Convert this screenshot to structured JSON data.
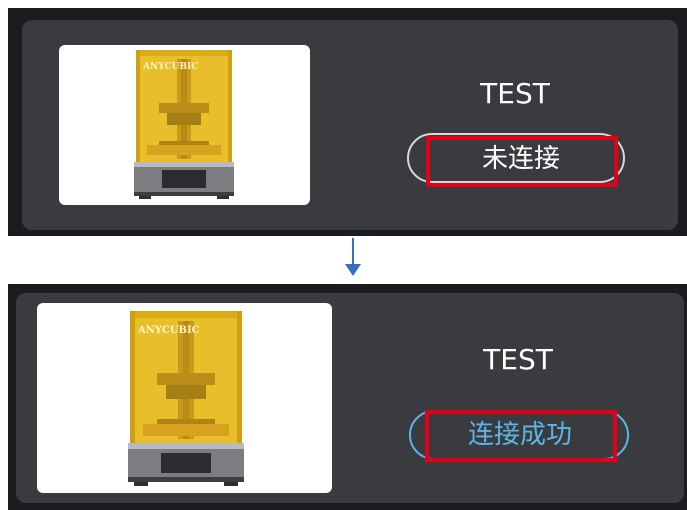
{
  "before": {
    "printer": {
      "name": "TEST",
      "brand_logo": "ANYCUBIC",
      "image_icon": "resin-3d-printer-image"
    },
    "status": {
      "label": "未连接",
      "color": "#ffffff",
      "pill_border": "#d8d8d8"
    }
  },
  "transition": {
    "icon": "arrow-down-icon",
    "color": "#3a6ebf"
  },
  "after": {
    "printer": {
      "name": "TEST",
      "brand_logo": "ANYCUBIC",
      "image_icon": "resin-3d-printer-image"
    },
    "status": {
      "label": "连接成功",
      "color": "#5ab6e8",
      "pill_border": "#5ab6e8"
    }
  },
  "highlight_color": "#e3001b",
  "theme": {
    "outer_bg": "#1b1c1f",
    "card_bg": "#3a3b3f",
    "printer_resin_yellow": "#e7bd2a"
  }
}
